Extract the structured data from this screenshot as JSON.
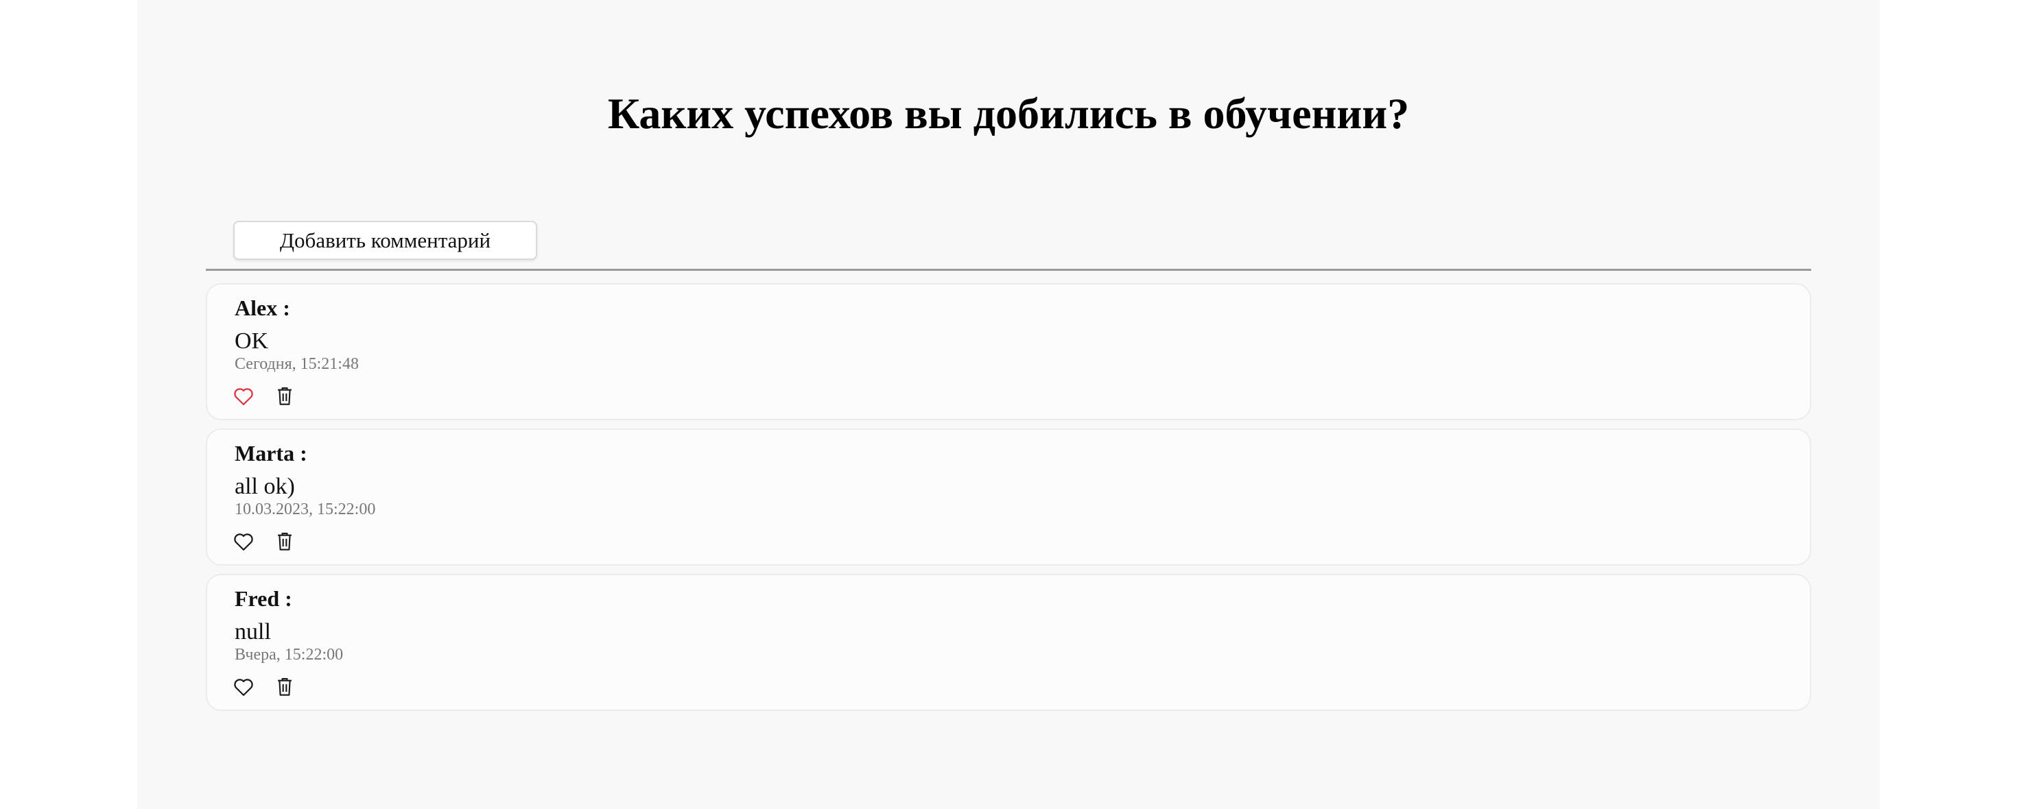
{
  "title": "Каких успехов вы добились в обучении?",
  "add_button_label": "Добавить комментарий",
  "colors": {
    "liked": "#e0303a",
    "unliked": "#1a1a1a"
  },
  "icons": {
    "like": "heart-icon",
    "delete": "trash-icon"
  },
  "comments": [
    {
      "author": "Alex :",
      "text": "OK",
      "date": "Сегодня, 15:21:48",
      "liked": true
    },
    {
      "author": "Marta :",
      "text": "all ok)",
      "date": "10.03.2023, 15:22:00",
      "liked": false
    },
    {
      "author": "Fred :",
      "text": "null",
      "date": "Вчера, 15:22:00",
      "liked": false
    }
  ]
}
